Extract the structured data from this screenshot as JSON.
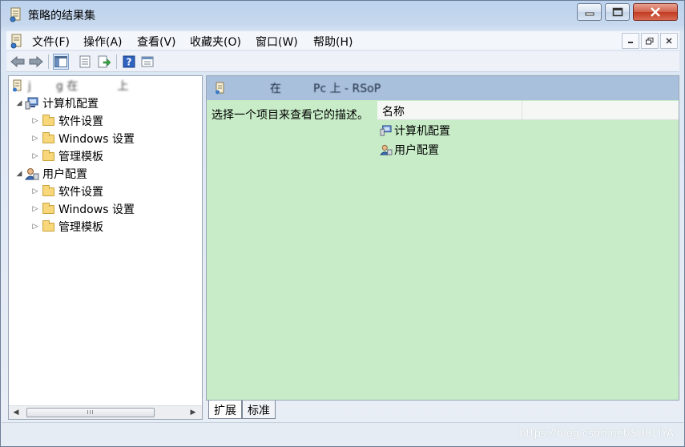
{
  "window": {
    "title": "策略的结果集"
  },
  "menu": {
    "items": [
      "文件(F)",
      "操作(A)",
      "查看(V)",
      "收藏夹(O)",
      "窗口(W)",
      "帮助(H)"
    ]
  },
  "tree": {
    "root_label": "j       g 在           上",
    "computer_config": "计算机配置",
    "user_config": "用户配置",
    "software_settings": "软件设置",
    "windows_settings": "Windows 设置",
    "admin_templates": "管理模板"
  },
  "right": {
    "header_title": "           在         Pc 上 - RSoP",
    "description": "选择一个项目来查看它的描述。",
    "column_name": "名称",
    "items": [
      "计算机配置",
      "用户配置"
    ]
  },
  "tabs": [
    "扩展",
    "标准"
  ],
  "status": {
    "watermark": "https://blog.csdn.net/SURLIYA"
  },
  "scrollbar": {
    "thumb_grip": "III"
  }
}
